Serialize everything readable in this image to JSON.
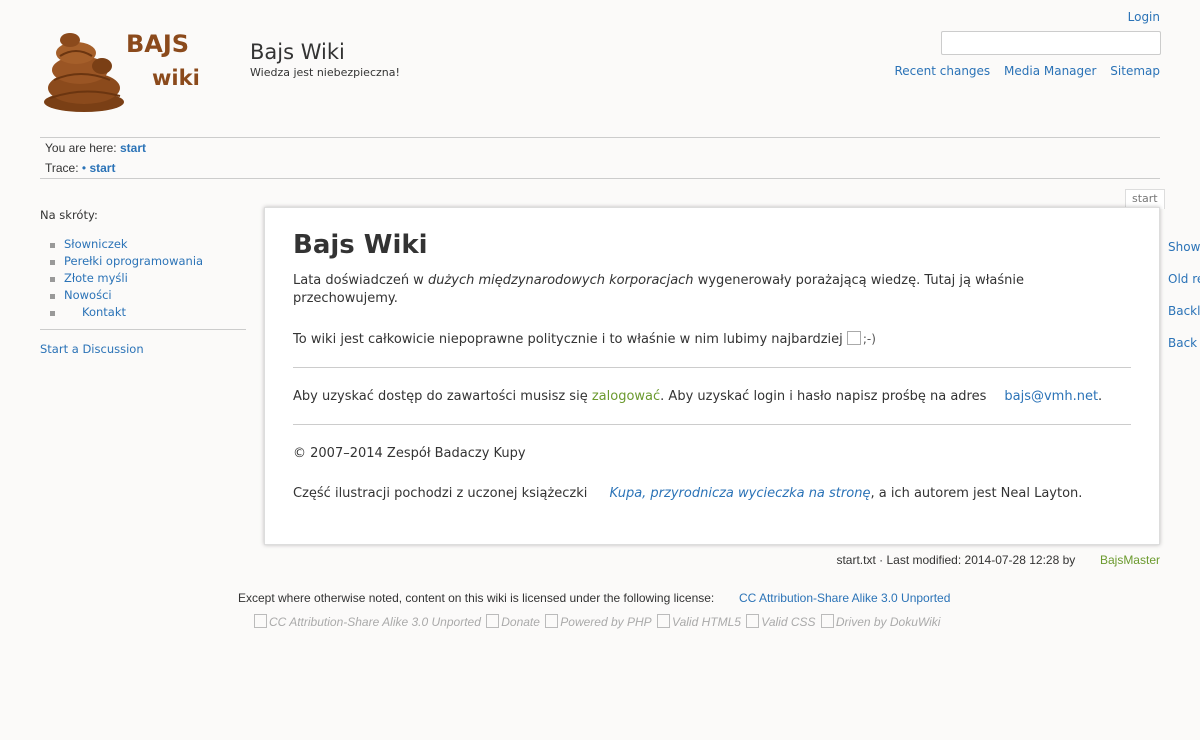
{
  "header": {
    "logo_text_1": "BAJS",
    "logo_text_2": "wiki",
    "site_title": "Bajs Wiki",
    "tagline": "Wiedza jest niebezpieczna!",
    "login_label": "Login",
    "search_value": "",
    "tools": [
      "Recent changes",
      "Media Manager",
      "Sitemap"
    ]
  },
  "breadcrumbs": {
    "you_are_here_label": "You are here:",
    "you_are_here_link": "start",
    "trace_label": "Trace:",
    "trace_bullet": "•",
    "trace_link": "start"
  },
  "sidebar": {
    "heading": "Na skróty:",
    "items": [
      "Słowniczek",
      "Perełki oprogramowania",
      "Złote myśli",
      "Nowości",
      "Kontakt"
    ],
    "discussion_link": "Start a Discussion"
  },
  "page": {
    "tab_label": "start",
    "title": "Bajs Wiki",
    "p1_before": "Lata doświadczeń w",
    "p1_emph": "dużych międzynarodowych korporacjach",
    "p1_after": "wygenerowały porażającą wiedzę. Tutaj ją właśnie przechowujemy.",
    "p2_text": "To wiki jest całkowicie niepoprawne politycznie i to właśnie w nim lubimy najbardziej",
    "p2_smiley_alt": ";-)",
    "p3_before": "Aby uzyskać dostęp do zawartości musisz się",
    "p3_link": "zalogować",
    "p3_middle": ". Aby uzyskać login i hasło napisz prośbę na adres",
    "p3_email": "bajs@vmh.net",
    "p3_end": ".",
    "p4_copyright": "© 2007–2014 Zespół Badaczy Kupy",
    "p5_before": "Część ilustracji pochodzi z uczonej książeczki",
    "p5_link": "Kupa, przyrodnicza wycieczka na stronę",
    "p5_after": ", a ich autorem jest Neal Layton."
  },
  "page_tools": [
    "Show",
    "Old re",
    "Backl",
    "Back t"
  ],
  "docinfo": {
    "text": "start.txt · Last modified: 2014-07-28 12:28 by",
    "author": "BajsMaster"
  },
  "footer": {
    "license_text": "Except where otherwise noted, content on this wiki is licensed under the following license:",
    "license_link": "CC Attribution-Share Alike 3.0 Unported",
    "badges": [
      "CC Attribution-Share Alike 3.0 Unported",
      "Donate",
      "Powered by PHP",
      "Valid HTML5",
      "Valid CSS",
      "Driven by DokuWiki"
    ]
  },
  "colors": {
    "link": "#2b73b7",
    "user_link": "#6b9a2e",
    "logo_brown": "#8b4a1c",
    "background": "#fbfaf9"
  }
}
